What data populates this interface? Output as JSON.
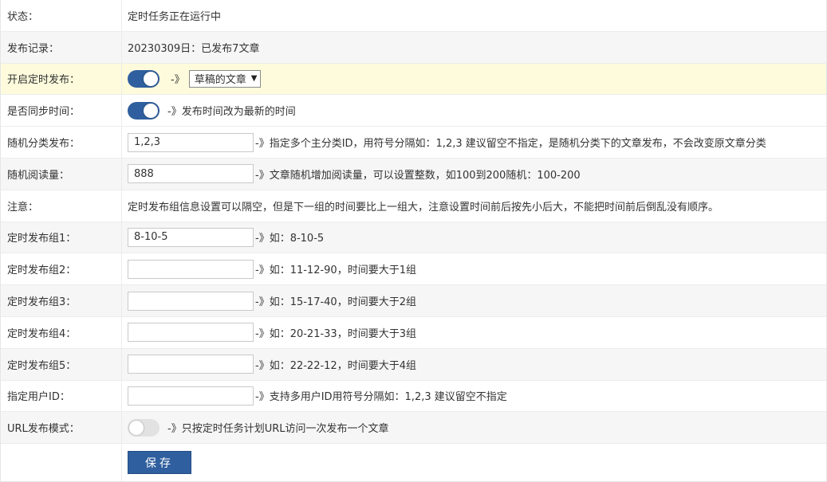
{
  "rows": {
    "status": {
      "label": "状态：",
      "value": "定时任务正在运行中"
    },
    "record": {
      "label": "发布记录：",
      "value": "20230309日：已发布7文章"
    },
    "enable": {
      "label": "开启定时发布：",
      "toggle": "on",
      "arrow": "-》",
      "select_value": "草稿的文章"
    },
    "sync": {
      "label": "是否同步时间：",
      "toggle": "on",
      "hint": "-》发布时间改为最新的时间"
    },
    "category": {
      "label": "随机分类发布：",
      "value": "1,2,3",
      "hint": "-》指定多个主分类ID，用符号分隔如：1,2,3 建议留空不指定，是随机分类下的文章发布，不会改变原文章分类"
    },
    "views": {
      "label": "随机阅读量：",
      "value": "888",
      "hint": "-》文章随机增加阅读量，可以设置整数，如100到200随机：100-200"
    },
    "note": {
      "label": "注意：",
      "value": "定时发布组信息设置可以隔空，但是下一组的时间要比上一组大，注意设置时间前后按先小后大，不能把时间前后倒乱没有顺序。"
    },
    "group1": {
      "label": "定时发布组1：",
      "value": "8-10-5",
      "hint": "-》如：8-10-5"
    },
    "group2": {
      "label": "定时发布组2：",
      "value": "",
      "hint": "-》如：11-12-90，时间要大于1组"
    },
    "group3": {
      "label": "定时发布组3：",
      "value": "",
      "hint": "-》如：15-17-40，时间要大于2组"
    },
    "group4": {
      "label": "定时发布组4：",
      "value": "",
      "hint": "-》如：20-21-33，时间要大于3组"
    },
    "group5": {
      "label": "定时发布组5：",
      "value": "",
      "hint": "-》如：22-22-12，时间要大于4组"
    },
    "user": {
      "label": "指定用户ID：",
      "value": "",
      "hint": "-》支持多用户ID用符号分隔如：1,2,3 建议留空不指定"
    },
    "url": {
      "label": "URL发布模式：",
      "toggle": "off",
      "hint": "-》只按定时任务计划URL访问一次发布一个文章"
    }
  },
  "save_label": "保存",
  "colors": {
    "accent": "#2f5f9e",
    "highlight_row": "#fdfbdc",
    "alt_row": "#f6f6f6"
  }
}
